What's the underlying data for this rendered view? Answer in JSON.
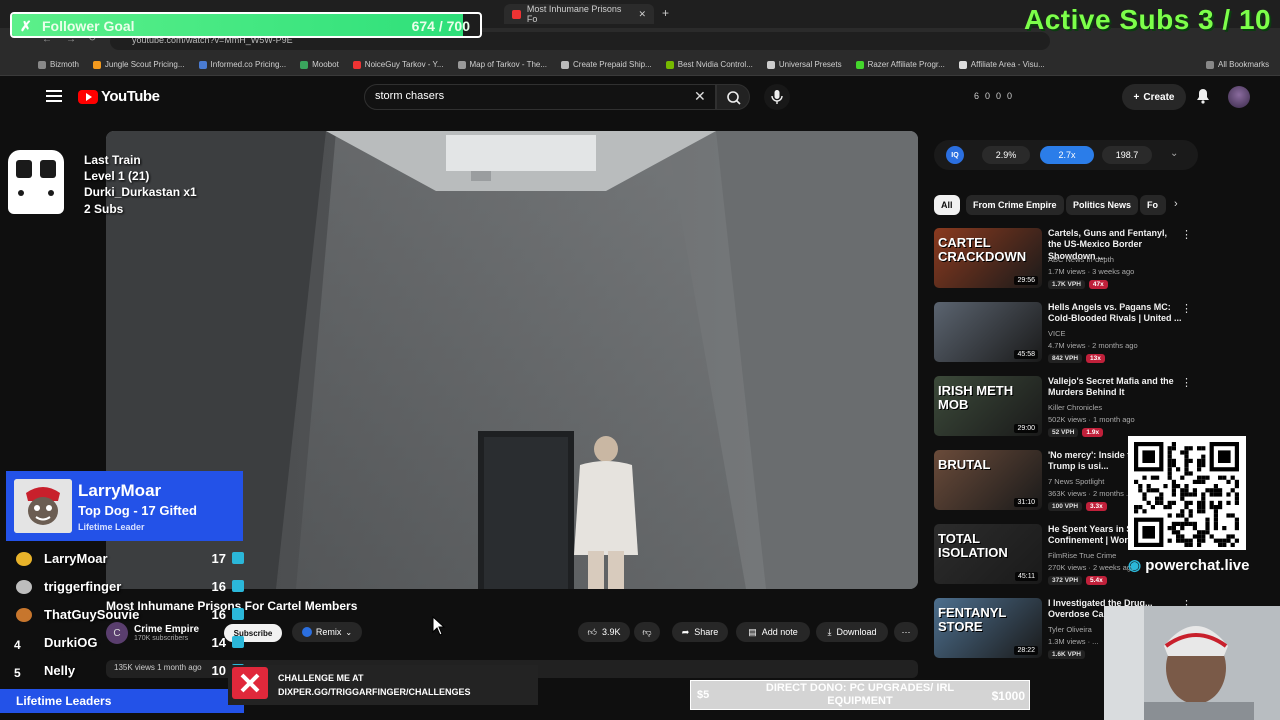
{
  "browser": {
    "tabs": [
      {
        "label": "Most Inhumane Prisons Fo",
        "active": true
      }
    ],
    "url": "youtube.com/watch?v=MmH_W5W-P9E",
    "bookmarks": [
      "Bizmoth",
      "Jungle Scout Pricing...",
      "Informed.co Pricing...",
      "Moobot",
      "NoiceGuy Tarkov - Y...",
      "Map of Tarkov - The...",
      "Create Prepaid Ship...",
      "Best Nvidia Control...",
      "Universal Presets",
      "Razer Affiliate Progr...",
      "Affiliate Area - Visu..."
    ],
    "all_bookmarks": "All Bookmarks"
  },
  "overlays": {
    "follower_goal": {
      "label": "Follower Goal",
      "count": "674 / 700",
      "progress": 0.963
    },
    "active_subs": "Active Subs  3 / 10",
    "last_train": {
      "line1": "Last Train",
      "line2": "Level 1  (21)",
      "line3": "Durki_Durkastan x1",
      "line4": "2 Subs"
    },
    "leader": {
      "name": "LarryMoar",
      "subtitle": "Top Dog - 17 Gifted",
      "tag": "Lifetime Leader"
    },
    "leaderboard": [
      {
        "rank": "",
        "name": "LarryMoar",
        "count": "17",
        "medal": "#e8b32a"
      },
      {
        "rank": "",
        "name": "triggerfinger",
        "count": "16",
        "medal": "#bdbdbd"
      },
      {
        "rank": "",
        "name": "ThatGuySouvie",
        "count": "16",
        "medal": "#c7762d"
      },
      {
        "rank": "4",
        "name": "DurkiOG",
        "count": "14",
        "medal": ""
      },
      {
        "rank": "5",
        "name": "Nelly",
        "count": "10",
        "medal": ""
      }
    ],
    "lifetime_leaders": "Lifetime Leaders",
    "challenge": {
      "line1": "CHALLENGE ME AT",
      "line2": "DIXPER.GG/TRIGGARFINGER/CHALLENGES"
    },
    "donation": {
      "min": "$5",
      "title": "DIRECT DONO: PC UPGRADES/ IRL EQUIPMENT",
      "max": "$1000"
    },
    "qr_caption": "powerchat.live"
  },
  "youtube": {
    "logo": "YouTube",
    "search_value": "storm chasers",
    "header_counts": [
      "6",
      "0",
      "0",
      "0"
    ],
    "create_label": "Create",
    "video": {
      "title": "Most Inhumane Prisons For Cartel Members",
      "channel": "Crime Empire",
      "channel_initial": "C",
      "subscribers": "170K subscribers",
      "subscribe_label": "Subscribe",
      "remix_label": "Remix",
      "likes": "3.9K",
      "share_label": "Share",
      "add_note_label": "Add note",
      "download_label": "Download",
      "views_line": "135K views  1 month ago"
    },
    "stats_pills": [
      "2.9%",
      "2.7x",
      "198.7"
    ],
    "stats_badge": "IQ",
    "chips": [
      "All",
      "From Crime Empire",
      "Politics News",
      "Fo"
    ],
    "recommendations": [
      {
        "title": "Cartels, Guns and Fentanyl, the US-Mexico Border Showdown ...",
        "channel": "ABC News In-depth",
        "meta": "1.7M views · 3 weeks ago",
        "vph": "1.7K VPH",
        "mult": "47x",
        "duration": "29:56",
        "thumb_text": "CARTEL\nCRACKDOWN",
        "thumb_color": "#8a3a1f"
      },
      {
        "title": "Hells Angels vs. Pagans MC: Cold-Blooded Rivals | United ...",
        "channel": "VICE",
        "meta": "4.7M views · 2 months ago",
        "vph": "842 VPH",
        "mult": "13x",
        "duration": "45:58",
        "thumb_text": "",
        "thumb_color": "#5b6470"
      },
      {
        "title": "Vallejo's Secret Mafia and the Murders Behind It",
        "channel": "Killer Chronicles",
        "meta": "502K views · 1 month ago",
        "vph": "52 VPH",
        "mult": "1.9x",
        "duration": "29:00",
        "thumb_text": "IRISH METH MOB",
        "thumb_color": "#3c4a3a"
      },
      {
        "title": "'No mercy': Inside the prison Trump is usi...",
        "channel": "7 News Spotlight",
        "meta": "363K views · 2 months ...",
        "vph": "100 VPH",
        "mult": "3.3x",
        "duration": "31:10",
        "thumb_text": "BRUTAL",
        "thumb_color": "#6a4b3a"
      },
      {
        "title": "He Spent Years in S... Confinement | World...",
        "channel": "FilmRise True Crime",
        "meta": "270K views · 2 weeks ago",
        "vph": "372 VPH",
        "mult": "5.4x",
        "duration": "45:11",
        "thumb_text": "TOTAL ISOLATION",
        "thumb_color": "#2c2c2c"
      },
      {
        "title": "I Investigated the Drug... Overdose Cap...",
        "channel": "Tyler Oliveira",
        "meta": "1.3M views · ...",
        "vph": "1.6K VPH",
        "mult": "",
        "duration": "28:22",
        "thumb_text": "FENTANYL STORE",
        "thumb_color": "#4d6f8e"
      }
    ]
  }
}
